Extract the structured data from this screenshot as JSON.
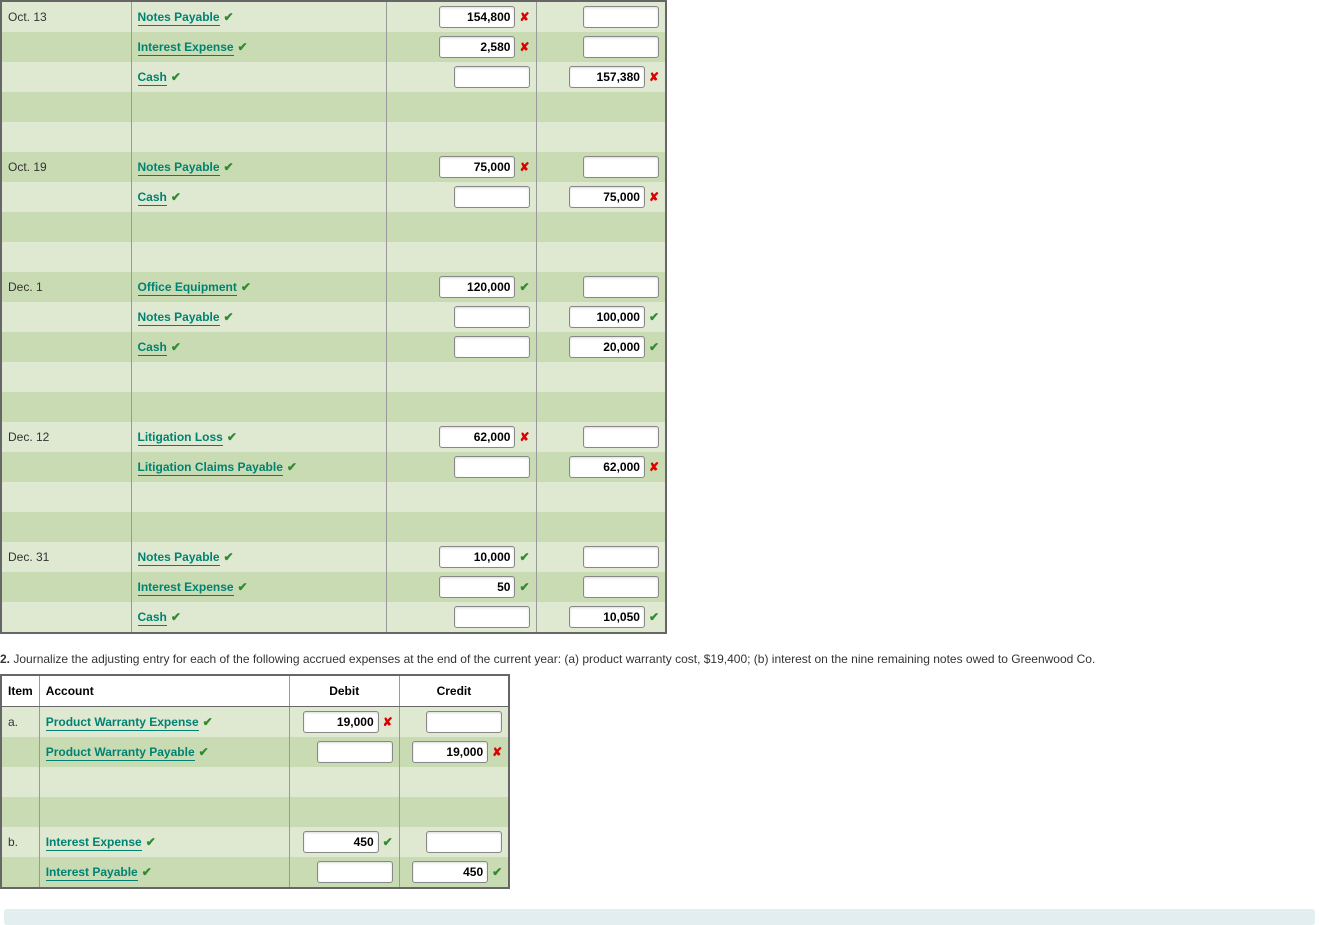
{
  "table1": {
    "rows": [
      {
        "cls": "odd",
        "date": "Oct. 13",
        "acct": "Notes Payable",
        "acctMark": "check",
        "debit": "154,800",
        "debitMark": "cross",
        "credit": "",
        "creditMark": ""
      },
      {
        "cls": "even",
        "date": "",
        "acct": "Interest Expense",
        "acctMark": "check",
        "debit": "2,580",
        "debitMark": "cross",
        "credit": "",
        "creditMark": ""
      },
      {
        "cls": "odd",
        "date": "",
        "acct": "Cash",
        "acctMark": "check",
        "debit": "",
        "debitMark": "",
        "credit": "157,380",
        "creditMark": "cross"
      },
      {
        "cls": "even spacer"
      },
      {
        "cls": "odd spacer"
      },
      {
        "cls": "even",
        "date": "Oct. 19",
        "acct": "Notes Payable",
        "acctMark": "check",
        "debit": "75,000",
        "debitMark": "cross",
        "credit": "",
        "creditMark": ""
      },
      {
        "cls": "odd",
        "date": "",
        "acct": "Cash",
        "acctMark": "check",
        "debit": "",
        "debitMark": "",
        "credit": "75,000",
        "creditMark": "cross"
      },
      {
        "cls": "even spacer"
      },
      {
        "cls": "odd spacer"
      },
      {
        "cls": "even",
        "date": "Dec. 1",
        "acct": "Office Equipment",
        "acctMark": "check",
        "debit": "120,000",
        "debitMark": "check",
        "credit": "",
        "creditMark": ""
      },
      {
        "cls": "odd",
        "date": "",
        "acct": "Notes Payable",
        "acctMark": "check",
        "debit": "",
        "debitMark": "",
        "credit": "100,000",
        "creditMark": "check"
      },
      {
        "cls": "even",
        "date": "",
        "acct": "Cash",
        "acctMark": "check",
        "debit": "",
        "debitMark": "",
        "credit": "20,000",
        "creditMark": "check"
      },
      {
        "cls": "odd spacer"
      },
      {
        "cls": "even spacer"
      },
      {
        "cls": "odd",
        "date": "Dec. 12",
        "acct": "Litigation Loss",
        "acctMark": "check",
        "debit": "62,000",
        "debitMark": "cross",
        "credit": "",
        "creditMark": ""
      },
      {
        "cls": "even",
        "date": "",
        "acct": "Litigation Claims Payable",
        "acctMark": "check",
        "debit": "",
        "debitMark": "",
        "credit": "62,000",
        "creditMark": "cross"
      },
      {
        "cls": "odd spacer"
      },
      {
        "cls": "even spacer"
      },
      {
        "cls": "odd",
        "date": "Dec. 31",
        "acct": "Notes Payable",
        "acctMark": "check",
        "debit": "10,000",
        "debitMark": "check",
        "credit": "",
        "creditMark": ""
      },
      {
        "cls": "even",
        "date": "",
        "acct": "Interest Expense",
        "acctMark": "check",
        "debit": "50",
        "debitMark": "check",
        "credit": "",
        "creditMark": ""
      },
      {
        "cls": "odd",
        "date": "",
        "acct": "Cash",
        "acctMark": "check",
        "debit": "",
        "debitMark": "",
        "credit": "10,050",
        "creditMark": "check"
      }
    ]
  },
  "question2": {
    "num": "2.",
    "text": "Journalize the adjusting entry for each of the following accrued expenses at the end of the current year: (a) product warranty cost, $19,400; (b) interest on the nine remaining notes owed to Greenwood Co."
  },
  "table2": {
    "headers": {
      "item": "Item",
      "acct": "Account",
      "debit": "Debit",
      "credit": "Credit"
    },
    "rows": [
      {
        "cls": "odd",
        "item": "a.",
        "acct": "Product Warranty Expense",
        "acctMark": "check",
        "debit": "19,000",
        "debitMark": "cross",
        "credit": "",
        "creditMark": ""
      },
      {
        "cls": "even",
        "item": "",
        "acct": "Product Warranty Payable",
        "acctMark": "check",
        "debit": "",
        "debitMark": "",
        "credit": "19,000",
        "creditMark": "cross"
      },
      {
        "cls": "odd spacer"
      },
      {
        "cls": "even spacer"
      },
      {
        "cls": "odd",
        "item": "b.",
        "acct": "Interest Expense",
        "acctMark": "check",
        "debit": "450",
        "debitMark": "check",
        "credit": "",
        "creditMark": ""
      },
      {
        "cls": "even",
        "item": "",
        "acct": "Interest Payable",
        "acctMark": "check",
        "debit": "",
        "debitMark": "",
        "credit": "450",
        "creditMark": "check"
      }
    ]
  },
  "marks": {
    "check": "✔",
    "cross": "✘"
  }
}
